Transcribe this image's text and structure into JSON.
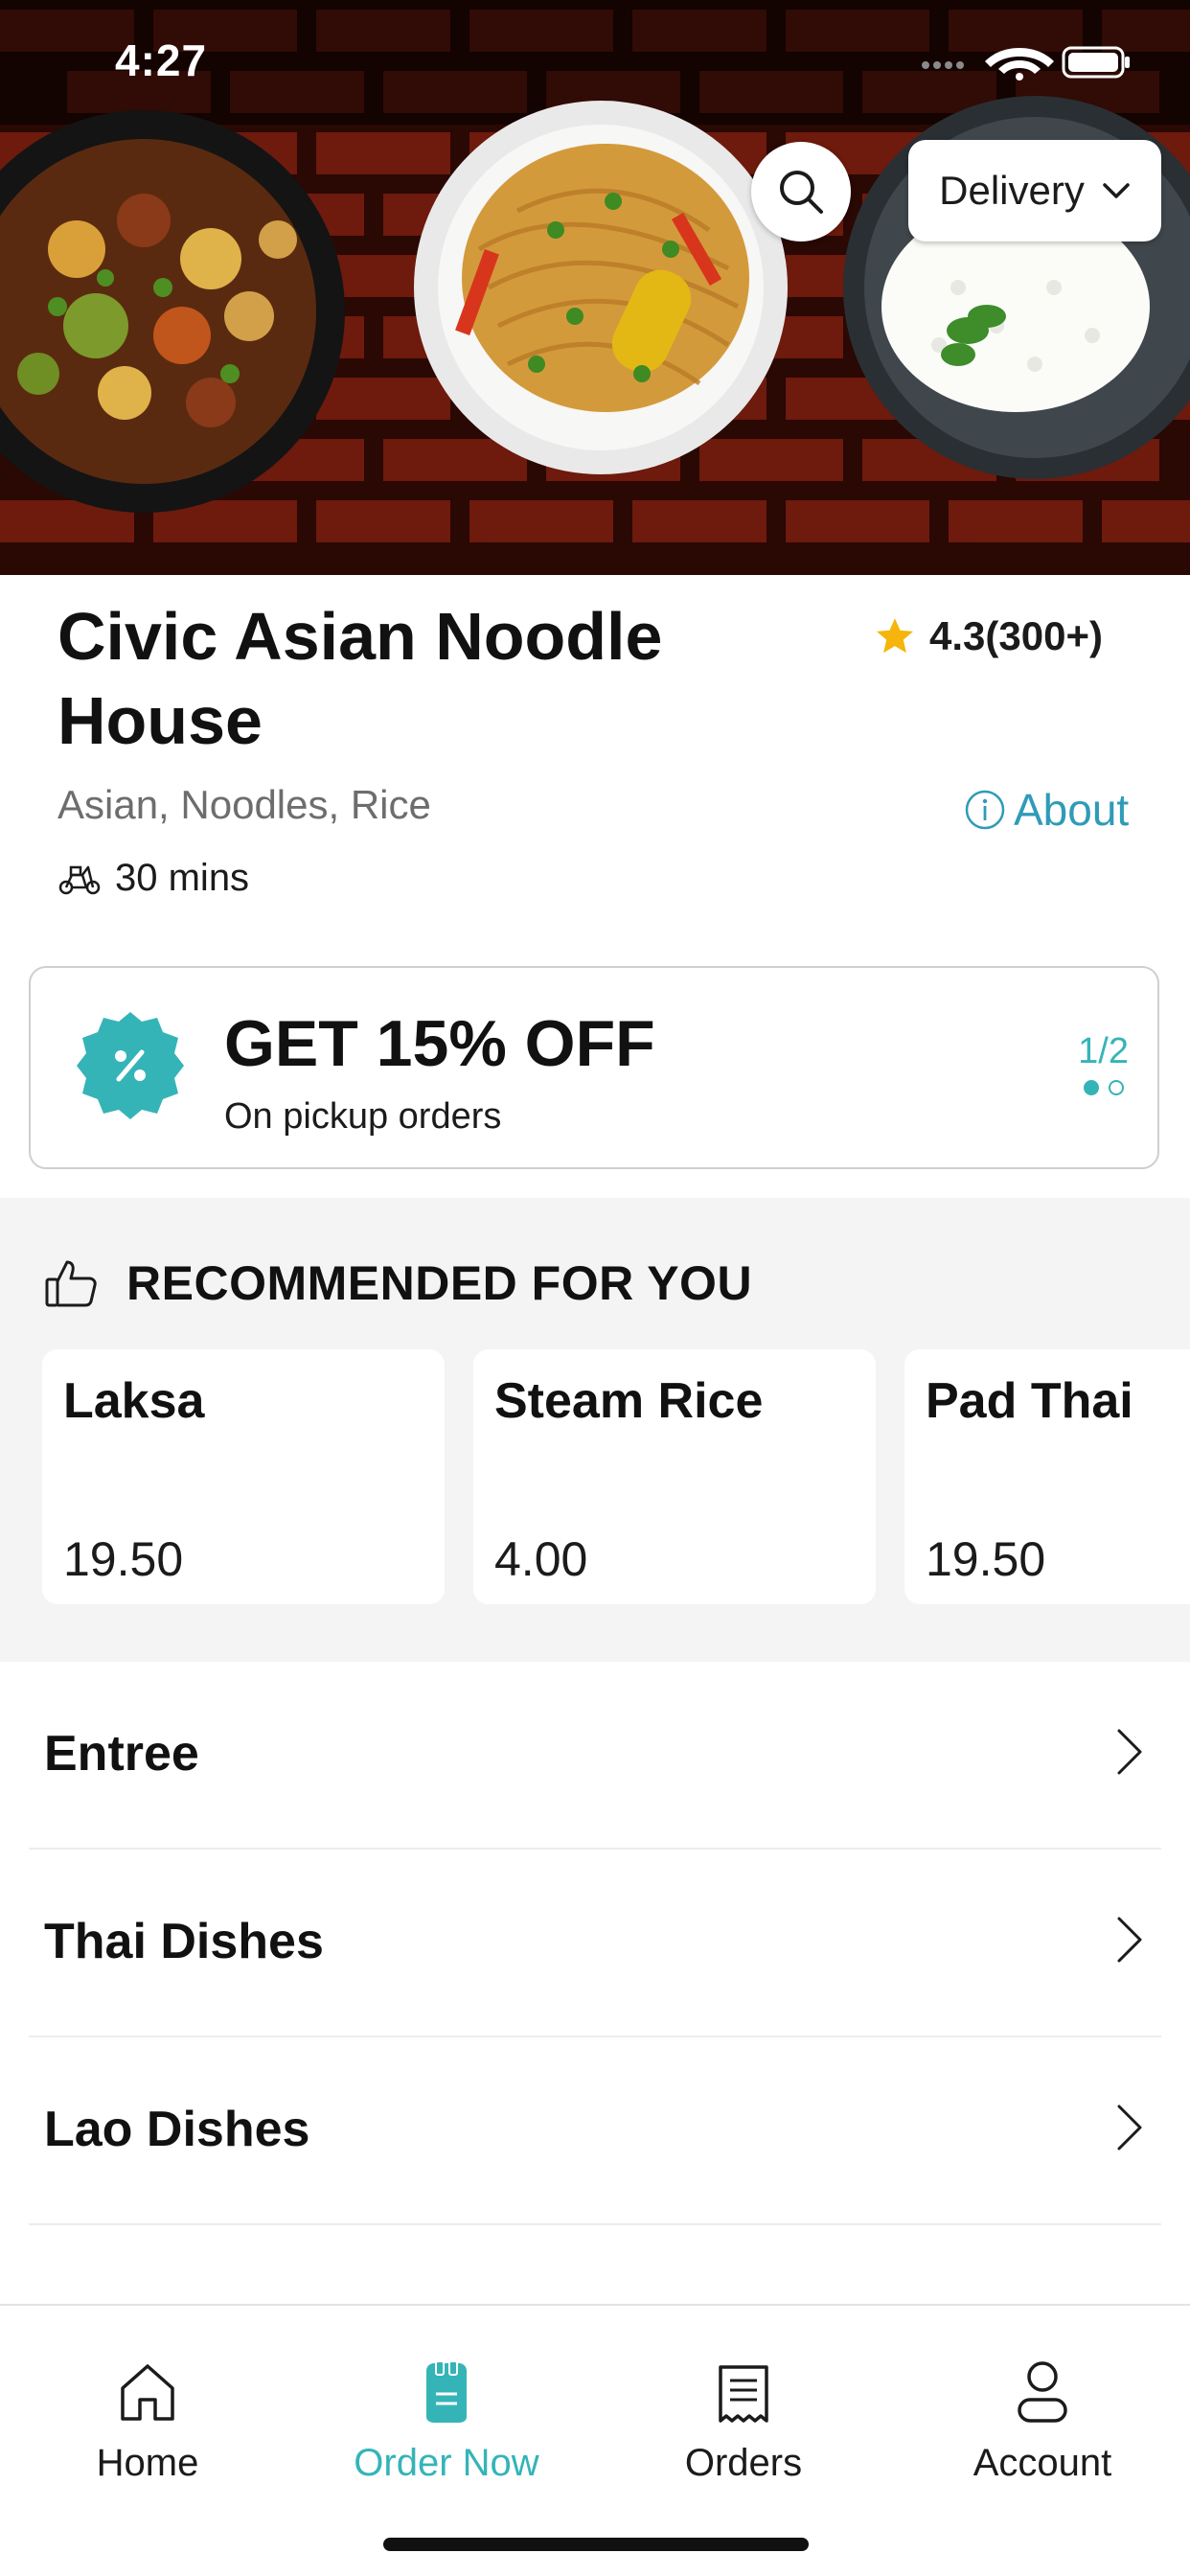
{
  "status_bar": {
    "time": "4:27"
  },
  "hero": {
    "mode_label": "Delivery"
  },
  "restaurant": {
    "name": "Civic Asian Noodle House",
    "rating": "4.3(300+)",
    "cuisines": "Asian, Noodles, Rice",
    "eta": "30 mins",
    "about_label": "About"
  },
  "promo": {
    "title": "GET 15% OFF",
    "subtitle": "On pickup orders",
    "pager": "1/2"
  },
  "recommended": {
    "title": "RECOMMENDED FOR YOU",
    "items": [
      {
        "name": "Laksa",
        "price": "19.50"
      },
      {
        "name": "Steam Rice",
        "price": "4.00"
      },
      {
        "name": "Pad Thai",
        "price": "19.50"
      }
    ]
  },
  "categories": [
    {
      "label": "Entree"
    },
    {
      "label": "Thai Dishes"
    },
    {
      "label": "Lao Dishes"
    }
  ],
  "tabbar": {
    "tabs": [
      {
        "label": "Home",
        "icon": "home-icon"
      },
      {
        "label": "Order Now",
        "icon": "order-icon"
      },
      {
        "label": "Orders",
        "icon": "receipt-icon"
      },
      {
        "label": "Account",
        "icon": "account-icon"
      }
    ],
    "active_index": 1
  },
  "colors": {
    "accent": "#35b4b8",
    "link": "#2f9bb8",
    "star": "#f5b50a"
  }
}
